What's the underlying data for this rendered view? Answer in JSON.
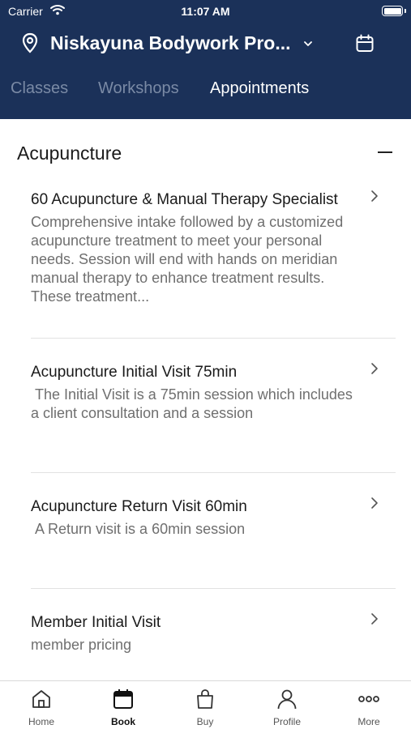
{
  "status_bar": {
    "carrier": "Carrier",
    "time": "11:07 AM"
  },
  "header": {
    "location": "Niskayuna Bodywork Pro...",
    "icons": [
      "location-pin-icon",
      "chevron-down-icon",
      "calendar-icon"
    ],
    "brand_color": "#1b3159"
  },
  "tabs": [
    {
      "label": "Classes",
      "active": false
    },
    {
      "label": "Workshops",
      "active": false
    },
    {
      "label": "Appointments",
      "active": true
    }
  ],
  "section": {
    "title": "Acupuncture",
    "collapse_icon": "minus-icon"
  },
  "items": [
    {
      "title": "60 Acupuncture & Manual Therapy Specialist",
      "description": "Comprehensive intake followed by a customized acupuncture treatment to meet your personal needs. Session will end with hands on meridian manual therapy to enhance treatment results. These treatment..."
    },
    {
      "title": "Acupuncture Initial Visit 75min",
      "description": " The Initial Visit is a 75min session which includes a client consultation and a session"
    },
    {
      "title": "Acupuncture Return Visit 60min",
      "description": " A Return visit is a 60min session"
    },
    {
      "title": "Member Initial Visit",
      "description": "member pricing"
    }
  ],
  "tab_bar": [
    {
      "label": "Home",
      "icon": "home-icon",
      "active": false
    },
    {
      "label": "Book",
      "icon": "calendar-icon",
      "active": true
    },
    {
      "label": "Buy",
      "icon": "shopping-bag-icon",
      "active": false
    },
    {
      "label": "Profile",
      "icon": "person-icon",
      "active": false
    },
    {
      "label": "More",
      "icon": "more-dots-icon",
      "active": false
    }
  ]
}
